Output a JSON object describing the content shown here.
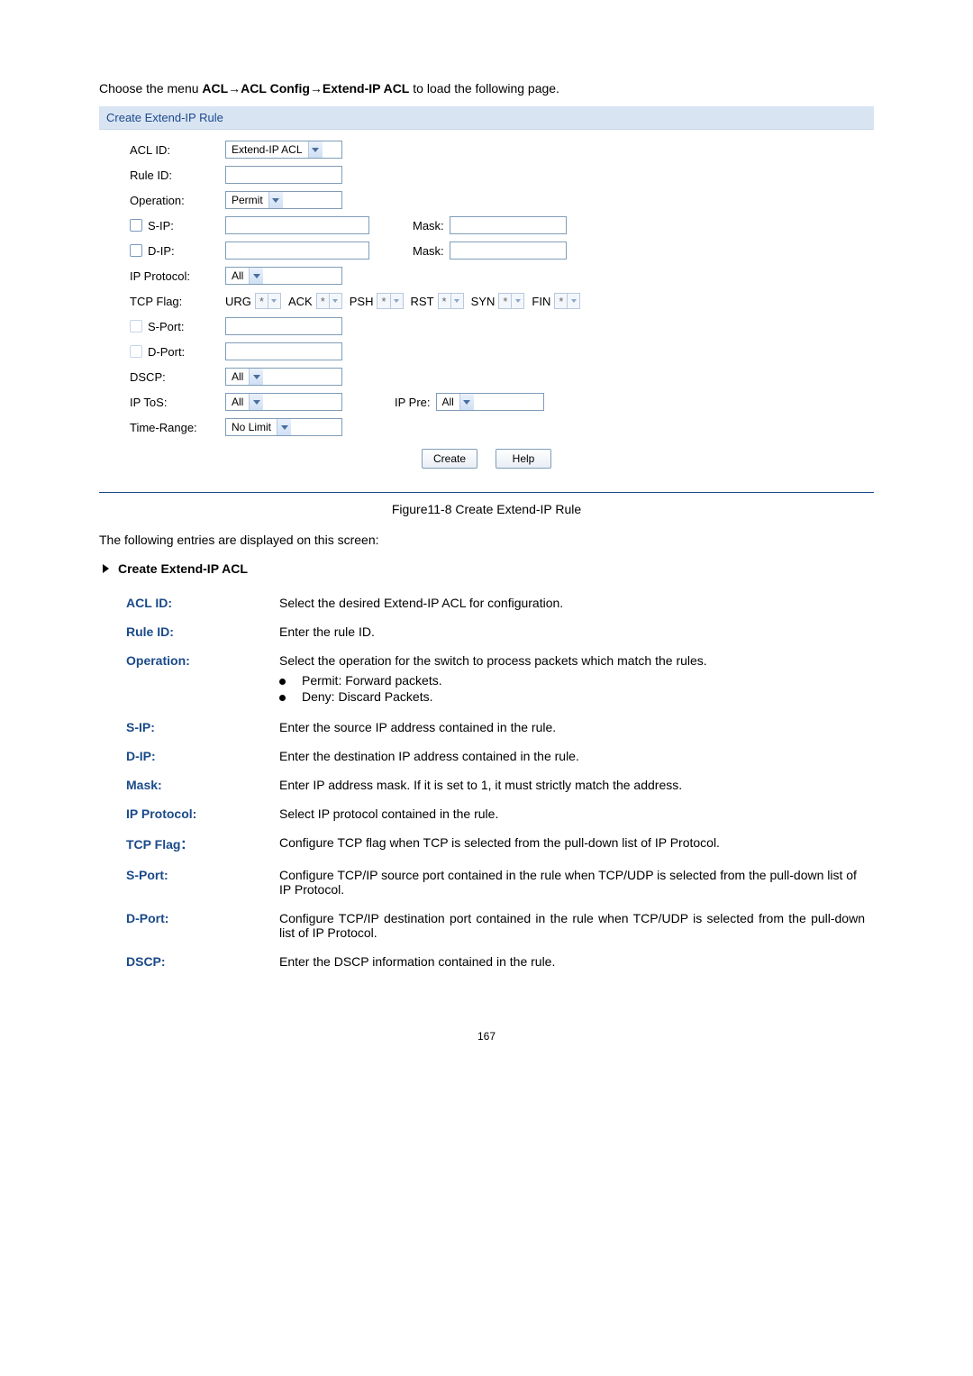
{
  "intro": {
    "prefix": "Choose the menu ",
    "bold": "ACL→ACL Config→Extend-IP ACL",
    "suffix": " to load the following page."
  },
  "panel": {
    "title": "Create Extend-IP Rule",
    "labels": {
      "acl_id": "ACL ID:",
      "rule_id": "Rule ID:",
      "operation": "Operation:",
      "s_ip": "S-IP:",
      "d_ip": "D-IP:",
      "ip_protocol": "IP Protocol:",
      "tcp_flag": "TCP Flag:",
      "s_port": "S-Port:",
      "d_port": "D-Port:",
      "dscp": "DSCP:",
      "ip_tos": "IP ToS:",
      "time_range": "Time-Range:",
      "mask": "Mask:",
      "ip_pre": "IP Pre:"
    },
    "values": {
      "acl_id_sel": "Extend-IP ACL",
      "operation_sel": "Permit",
      "ip_protocol_sel": "All",
      "dscp_sel": "All",
      "ip_tos_sel": "All",
      "ip_pre_sel": "All",
      "time_range_sel": "No Limit",
      "flag_value": "*"
    },
    "flags": [
      "URG",
      "ACK",
      "PSH",
      "RST",
      "SYN",
      "FIN"
    ],
    "buttons": {
      "create": "Create",
      "help": "Help"
    }
  },
  "figure_caption": "Figure11-8 Create Extend-IP Rule",
  "entries_line": "The following entries are displayed on this screen:",
  "section_title": "Create Extend-IP ACL",
  "definitions": [
    {
      "key": "ACL ID:",
      "value": "Select the desired Extend-IP ACL for configuration."
    },
    {
      "key": "Rule ID:",
      "value": "Enter the rule ID."
    },
    {
      "key": "Operation:",
      "value": "Select the operation for the switch to process packets which match the rules.",
      "bullets": [
        "Permit: Forward packets.",
        "Deny: Discard Packets."
      ]
    },
    {
      "key": "S-IP:",
      "value": "Enter the source IP address contained in the rule."
    },
    {
      "key": "D-IP:",
      "value": "Enter the destination IP address contained in the rule."
    },
    {
      "key": "Mask:",
      "value": "Enter IP address mask. If it is set to 1, it must strictly match the address.",
      "justify": true
    },
    {
      "key": "IP Protocol:",
      "value": "Select IP protocol contained in the rule."
    },
    {
      "key": "TCP Flag：",
      "value": "Configure TCP flag when TCP is selected from the pull-down list of IP Protocol."
    },
    {
      "key": "S-Port:",
      "value": "Configure TCP/IP source port contained in the rule when TCP/UDP is selected from the pull-down list of IP Protocol."
    },
    {
      "key": "D-Port:",
      "value": "Configure TCP/IP destination port contained in the rule when TCP/UDP is selected from the pull-down list of IP Protocol.",
      "justify": true
    },
    {
      "key": "DSCP:",
      "value": "Enter the DSCP information contained in the rule."
    }
  ],
  "page_number": "167"
}
